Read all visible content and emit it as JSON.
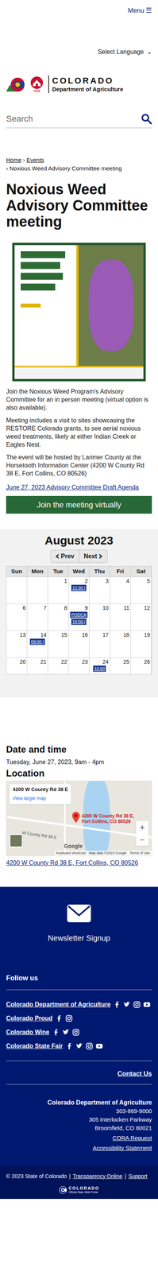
{
  "header": {
    "menu": "Menu",
    "menu_icon": "☰",
    "language": "Select Language",
    "language_icon": "⌄"
  },
  "logo": {
    "badge": "CDA",
    "name": "COLORADO",
    "department": "Department of Agriculture"
  },
  "search": {
    "placeholder": "Search"
  },
  "breadcrumb": {
    "items": [
      "Home",
      "Events"
    ],
    "separator": "›",
    "current": "Noxious Weed Advisory Committee meeting"
  },
  "title": "Noxious Weed Advisory Committee meeting",
  "body": [
    "Join the Noxious Weed Program's Advisory Committee for an in person meeting (virtual option is also available).",
    "Meeting includes a visit to sites showcasing the RESTORE Colorado grants, to see aerial noxious weed treatments, likely at either Indian Creek or Eagles Nest.",
    "The event will be hosted by Larimer County at the Horsetooth Information Center (4200 W County Rd 38 E, Fort Collins, CO 80526)"
  ],
  "agenda_link": "June 27, 2023 Advisory Committee Draft Agenda",
  "join_button": "Join the meeting virtually",
  "calendar": {
    "month": "August 2023",
    "prev": "Prev",
    "next": "Next",
    "days": [
      "Sun",
      "Mon",
      "Tue",
      "Wed",
      "Thu",
      "Fri",
      "Sat"
    ],
    "weeks": [
      [
        {
          "day": "",
          "events": []
        },
        {
          "day": "",
          "events": []
        },
        {
          "day": "1",
          "events": []
        },
        {
          "day": "2",
          "events": [
            "12:30 |"
          ]
        },
        {
          "day": "3",
          "events": []
        },
        {
          "day": "4",
          "events": []
        },
        {
          "day": "5",
          "events": []
        }
      ],
      [
        {
          "day": "6",
          "events": []
        },
        {
          "day": "7",
          "events": []
        },
        {
          "day": "8",
          "events": []
        },
        {
          "day": "9",
          "events": [
            "PODCA",
            "10:00 |"
          ]
        },
        {
          "day": "10",
          "events": []
        },
        {
          "day": "11",
          "events": []
        },
        {
          "day": "12",
          "events": []
        }
      ],
      [
        {
          "day": "13",
          "events": []
        },
        {
          "day": "14",
          "events": [
            "09:00 |"
          ]
        },
        {
          "day": "15",
          "events": []
        },
        {
          "day": "16",
          "events": []
        },
        {
          "day": "17",
          "events": []
        },
        {
          "day": "18",
          "events": []
        },
        {
          "day": "19",
          "events": []
        }
      ],
      [
        {
          "day": "20",
          "events": []
        },
        {
          "day": "21",
          "events": []
        },
        {
          "day": "22",
          "events": []
        },
        {
          "day": "23",
          "events": []
        },
        {
          "day": "24",
          "events": [
            "10:00"
          ]
        },
        {
          "day": "25",
          "events": []
        },
        {
          "day": "26",
          "events": []
        }
      ]
    ]
  },
  "date_time": {
    "heading": "Date and time",
    "value": "Tuesday, June 27, 2023, 9am - 4pm"
  },
  "location": {
    "heading": "Location",
    "map": {
      "place": "4200 W County Rd 38 E",
      "larger": "View larger map",
      "road": "W County Rd 38 E",
      "pin_label": "4200 W County Rd 38 E, Fort Collins, CO 80526",
      "zoom_in": "+",
      "zoom_out": "−",
      "brand": "Google",
      "shortcuts": "Keyboard shortcuts",
      "data": "Map data ©2023 Google",
      "terms": "Terms of Use"
    },
    "address_link": "4200 W County Rd 38 E, Fort Collins, CO 80526"
  },
  "footer": {
    "newsletter": "Newsletter Signup",
    "follow": "Follow us",
    "social": [
      {
        "name": "Colorado Department of Agriculture",
        "networks": [
          {
            "kind": "facebook"
          },
          {
            "kind": "twitter"
          },
          {
            "kind": "instagram"
          },
          {
            "kind": "youtube"
          }
        ]
      },
      {
        "name": "Colorado Proud",
        "networks": [
          {
            "kind": "facebook"
          },
          {
            "kind": "instagram"
          }
        ]
      },
      {
        "name": "Colorado Wine",
        "networks": [
          {
            "kind": "facebook"
          },
          {
            "kind": "twitter"
          },
          {
            "kind": "instagram"
          }
        ]
      },
      {
        "name": "Colorado State Fair",
        "networks": [
          {
            "kind": "facebook"
          },
          {
            "kind": "twitter"
          },
          {
            "kind": "instagram"
          },
          {
            "kind": "youtube"
          }
        ]
      }
    ],
    "contact": "Contact Us",
    "org": "Colorado Department of Agriculture",
    "phone": "303-869-9000",
    "street": "305 Interlocken Parkway",
    "city": "Broomfield, CO 80021",
    "cora": "CORA Request",
    "accessibility": "Accessibility Statement",
    "bottom": {
      "copyright": "© 2023 State of Colorado",
      "separator": "|",
      "transparency": "Transparency Online",
      "support": "Support",
      "portal_name": "COLORADO",
      "portal_sub": "Official State Web Portal"
    }
  }
}
